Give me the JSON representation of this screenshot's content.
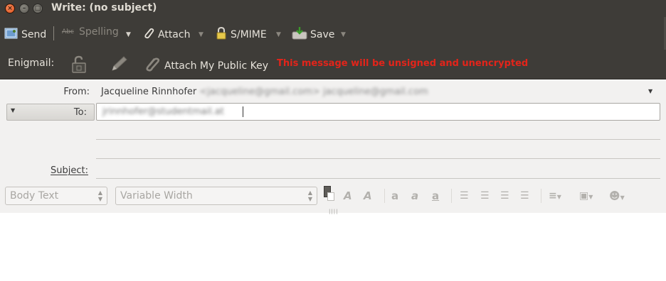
{
  "window": {
    "title": "Write: (no subject)",
    "controls": {
      "close": "×",
      "minimize": "–",
      "maximize": "□"
    }
  },
  "toolbar": {
    "send": "Send",
    "spelling": "Spelling",
    "attach": "Attach",
    "smime": "S/MIME",
    "save": "Save",
    "spelling_icon_text": "Abc"
  },
  "enigmail": {
    "label": "Enigmail:",
    "attach_key": "Attach My Public Key",
    "warning": "This message will be unsigned and unencrypted",
    "warning_color": "#e3241a"
  },
  "header": {
    "from_label": "From:",
    "from_name": "Jacqueline Rinnhofer",
    "from_email_blurred": "<jacqueline@gmail.com>  jacqueline@gmail.com",
    "to_type": "To:",
    "to_value_blurred": "jrinnhofer@studentmail.at",
    "subject_label": "Subject:",
    "subject_value": ""
  },
  "format_bar": {
    "paragraph_style": "Body Text",
    "font": "Variable Width"
  },
  "icons": [
    "send-icon",
    "spelling-icon",
    "paperclip-icon",
    "lock-icon",
    "save-icon",
    "unlocked-icon",
    "pencil-icon",
    "key-attach-icon",
    "text-color-icon",
    "smaller-font-icon",
    "larger-font-icon",
    "bold-icon",
    "italic-icon",
    "underline-icon",
    "bullet-list-icon",
    "numbered-list-icon",
    "outdent-icon",
    "indent-icon",
    "align-icon",
    "insert-image-icon",
    "smiley-icon"
  ],
  "colors": {
    "toolbar_bg": "#3e3c38",
    "header_bg": "#f2f1f0",
    "close_button": "#e0531c"
  }
}
